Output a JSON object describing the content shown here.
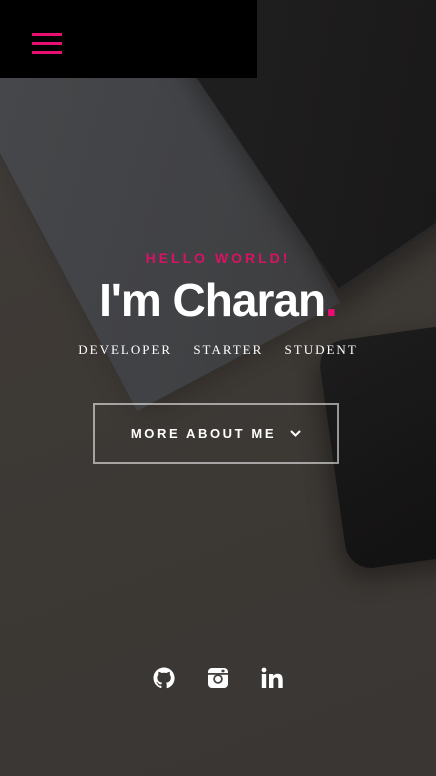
{
  "header": {
    "menu_icon": "hamburger-menu-icon",
    "accent_color": "#e80f72"
  },
  "hero": {
    "greeting": "HELLO WORLD!",
    "headline": "I'm Charan",
    "headline_punctuation": ".",
    "roles": [
      "DEVELOPER",
      "STARTER",
      "STUDENT"
    ],
    "cta_label": "MORE ABOUT ME",
    "cta_icon": "chevron-down-icon"
  },
  "social": {
    "links": [
      {
        "icon": "github-icon"
      },
      {
        "icon": "instagram-icon"
      },
      {
        "icon": "linkedin-icon"
      }
    ]
  }
}
